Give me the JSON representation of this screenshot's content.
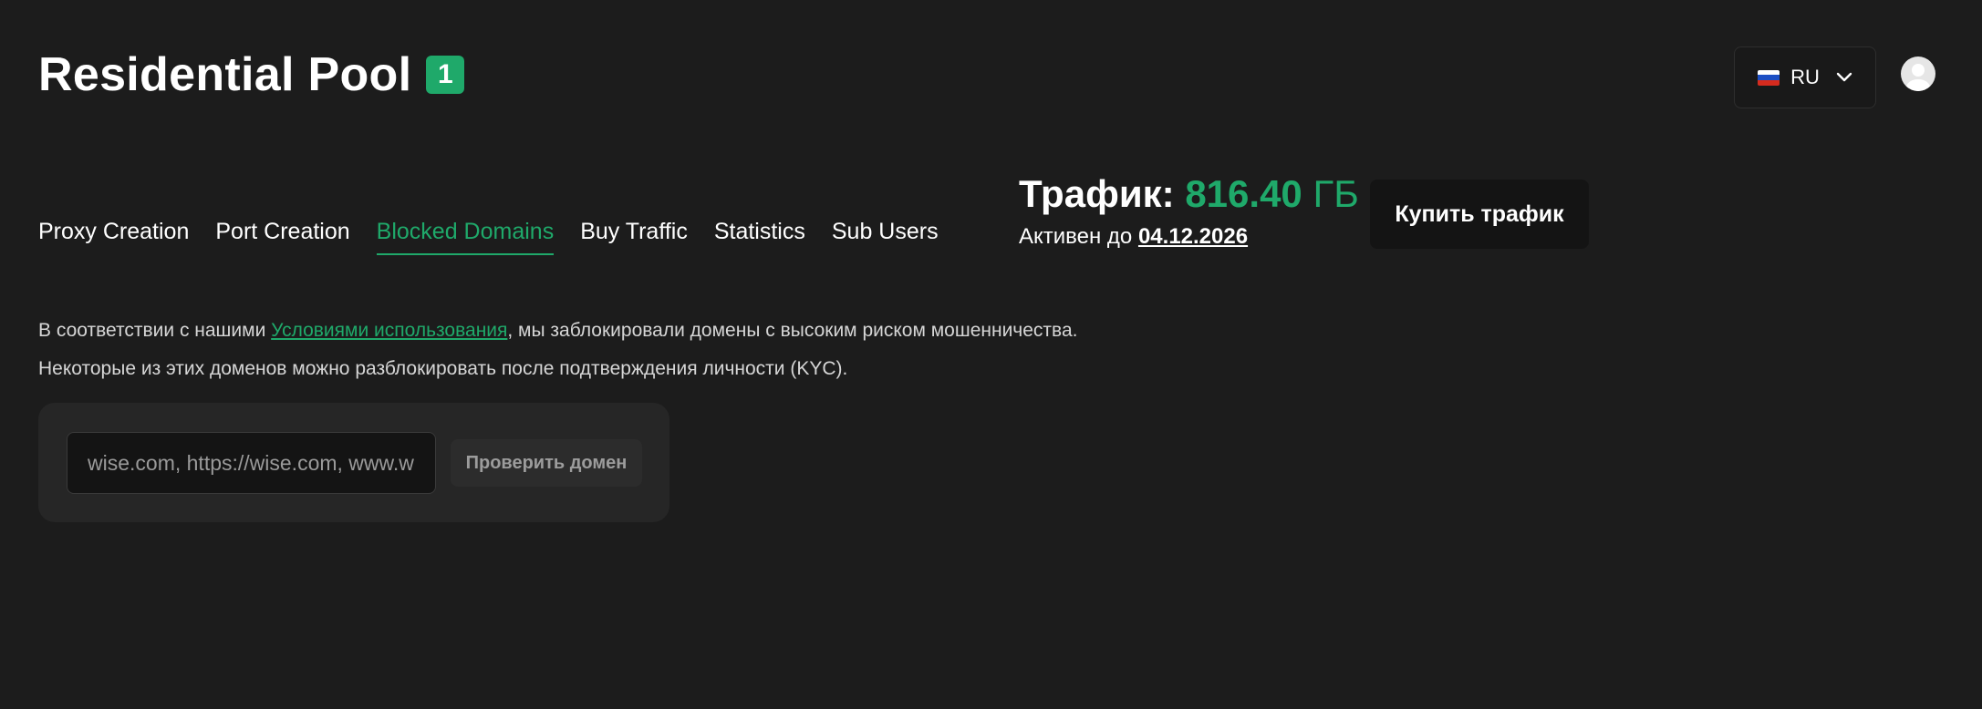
{
  "header": {
    "title": "Residential Pool",
    "badge_count": "1"
  },
  "language": {
    "flag": "russia-flag-icon",
    "selected": "RU"
  },
  "tabs": [
    {
      "label": "Proxy Creation",
      "active": false
    },
    {
      "label": "Port Creation",
      "active": false
    },
    {
      "label": "Blocked Domains",
      "active": true
    },
    {
      "label": "Buy Traffic",
      "active": false
    },
    {
      "label": "Statistics",
      "active": false
    },
    {
      "label": "Sub Users",
      "active": false
    }
  ],
  "traffic": {
    "label": "Трафик:",
    "value": "816.40",
    "unit": "ГБ",
    "active_prefix": "Активен до",
    "active_date": "04.12.2026",
    "buy_label": "Купить трафик"
  },
  "description": {
    "line1_before": "В соответствии с нашими ",
    "terms_link": "Условиями использования",
    "line1_after": ", мы заблокировали домены с высоким риском мошенничества.",
    "line2": "Некоторые из этих доменов можно разблокировать после подтверждения личности (KYC)."
  },
  "check": {
    "placeholder": "wise.com, https://wise.com, www.wise.com",
    "button_label": "Проверить домен"
  },
  "colors": {
    "accent": "#1fa96a",
    "background": "#1c1c1c"
  }
}
